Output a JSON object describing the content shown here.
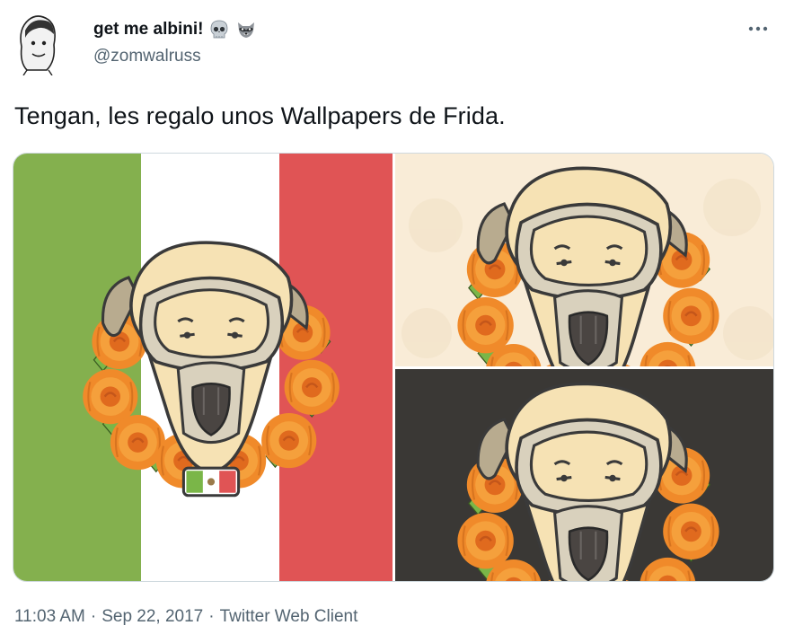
{
  "author": {
    "display_name": "get me albini!",
    "handle": "@zomwalruss",
    "badges": [
      "skull-emoji",
      "raccoon-emoji"
    ]
  },
  "tweet": {
    "text": "Tengan, les regalo unos Wallpapers de Frida."
  },
  "media": {
    "images": [
      {
        "alt": "wallpaper-mexican-flag",
        "background": [
          "#84b04e",
          "#ffffff",
          "#e05455"
        ]
      },
      {
        "alt": "wallpaper-cream",
        "background": "#f9ecd7"
      },
      {
        "alt": "wallpaper-dark",
        "background": "#3a3835"
      }
    ]
  },
  "meta": {
    "time": "11:03 AM",
    "separator": "·",
    "date": "Sep 22, 2017",
    "source": "Twitter Web Client"
  },
  "colors": {
    "text": "#0f1419",
    "secondary": "#536471",
    "border": "#cfd9de",
    "flower": "#f08a2a",
    "leaf": "#7ab648"
  }
}
